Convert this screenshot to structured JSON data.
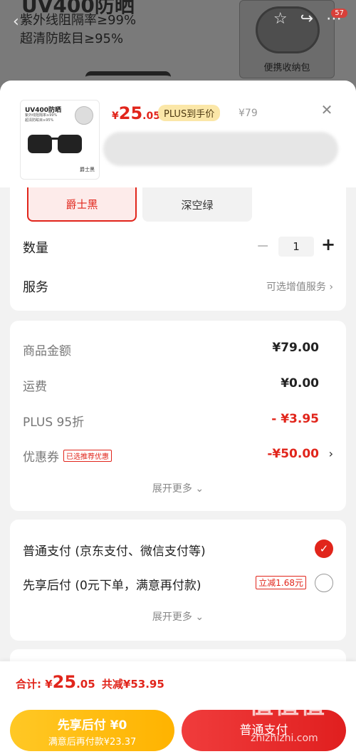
{
  "background": {
    "headline": "UV400防晒",
    "line1": "紫外线阻隔率≥99%",
    "line2": "超清防眩目≥95%",
    "case_label": "便携收纳包",
    "cart_badge": "57"
  },
  "product": {
    "thumb_title": "UV400防晒",
    "thumb_sub1": "紫外线阻隔率≥99%",
    "thumb_sub2": "超清防眩目≥95%",
    "thumb_color": "爵士黑",
    "price_symbol": "¥",
    "price_int": "25",
    "price_dec": ".05",
    "plus_tag": "PLUS到手价",
    "original_price": "¥79"
  },
  "spec": {
    "colors": [
      "爵士黑",
      "深空绿"
    ],
    "qty_label": "数量",
    "qty_value": "1",
    "service_label": "服务",
    "service_link": "可选增值服务"
  },
  "amounts": {
    "goods_label": "商品金额",
    "goods_value": "¥79.00",
    "shipping_label": "运费",
    "shipping_value": "¥0.00",
    "plus_label": "PLUS 95折",
    "plus_value": "- ¥3.95",
    "coupon_label": "优惠券",
    "coupon_tag": "已选推荐优惠",
    "coupon_value": "-¥50.00",
    "more": "展开更多"
  },
  "payment": {
    "normal": "普通支付 (京东支付、微信支付等)",
    "later": "先享后付 (0元下单，满意再付款)",
    "later_tag": "立减1.68元",
    "more": "展开更多"
  },
  "footer": {
    "total_label": "合计:",
    "total_symbol": "¥",
    "total_int": "25",
    "total_dec": ".05",
    "saving": "共减¥53.95",
    "later_line1": "先享后付 ¥0",
    "later_line2": "满意后再付款¥23.37",
    "pay_button": "普通支付"
  },
  "watermark": {
    "logo": "值值值",
    "site": "zhizhizhi.com"
  },
  "colors": {
    "accent": "#e1251b",
    "plus_bg": "#fbe7a8",
    "later_btn": "#ffbe1f"
  }
}
